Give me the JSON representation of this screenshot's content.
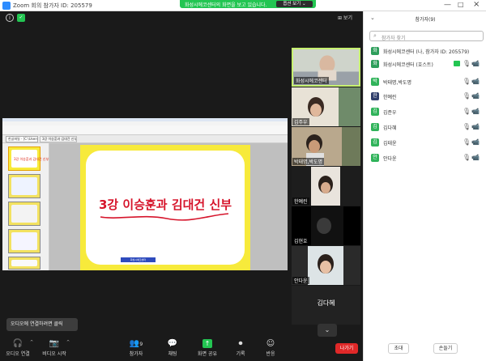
{
  "window": {
    "title": "Zoom 회의 참가자 ID: 205579",
    "min_glyph": "—",
    "max_glyph": "□",
    "close_glyph": "×"
  },
  "share_banner": {
    "text": "화성시에코센터의 화면을 보고 있습니다.",
    "options_label": "옵션 보기 ⌄"
  },
  "meeting": {
    "view_label": "⊞ 보기",
    "info_glyph": "i",
    "shield_glyph": "✓"
  },
  "shared_screen": {
    "tab1_label": "한글파일 - [C:\\Users\\...]",
    "tab2_label": "3강 이승훈과 김대건 신부.pptx",
    "thumb1_text": "3강 이승훈과 김대건 신부",
    "slide_title": "3강 이승훈과 김대건 신부",
    "slide_ribbon": "화성시에코센터"
  },
  "videos": [
    {
      "name": "화성시에코센터"
    },
    {
      "name": "김주우"
    },
    {
      "name": "박태명,박도명"
    },
    {
      "name": "한예린"
    },
    {
      "name": "김현호"
    },
    {
      "name": "안다윤"
    }
  ],
  "name_only_tile": "김다혜",
  "chevron_glyph": "⌄",
  "audio_tooltip": "오디오에 연결하려면 클릭",
  "toolbar": {
    "audio": "오디오 연결",
    "video": "비디오 시작",
    "participants": "참가자",
    "participants_count": "9",
    "chat": "채팅",
    "share": "화면 공유",
    "record": "기록",
    "reactions": "반응",
    "leave": "나가기",
    "up_glyph": "^"
  },
  "panel": {
    "title": "참가자(9)",
    "collapse_glyph": "⌄",
    "search_placeholder": "참가자 찾기",
    "participants": [
      {
        "initial": "화",
        "name": "화성시에코센터 (나, 참가자 ID: 205579)",
        "color": "#2e9e5b"
      },
      {
        "initial": "화",
        "name": "화성시에코센터 (호스트)",
        "color": "#2e9e5b"
      },
      {
        "initial": "박",
        "name": "박태명,박도명",
        "color": "#30b35a"
      },
      {
        "initial": "한",
        "name": "한예린",
        "color": "#2f3e6b"
      },
      {
        "initial": "김",
        "name": "김준우",
        "color": "#30b35a"
      },
      {
        "initial": "김",
        "name": "김다혜",
        "color": "#30b35a"
      },
      {
        "initial": "김",
        "name": "김태윤",
        "color": "#30b35a"
      },
      {
        "initial": "안",
        "name": "안다윤",
        "color": "#30b35a"
      }
    ],
    "invite_label": "초대",
    "raise_hand_label": "손들기"
  }
}
